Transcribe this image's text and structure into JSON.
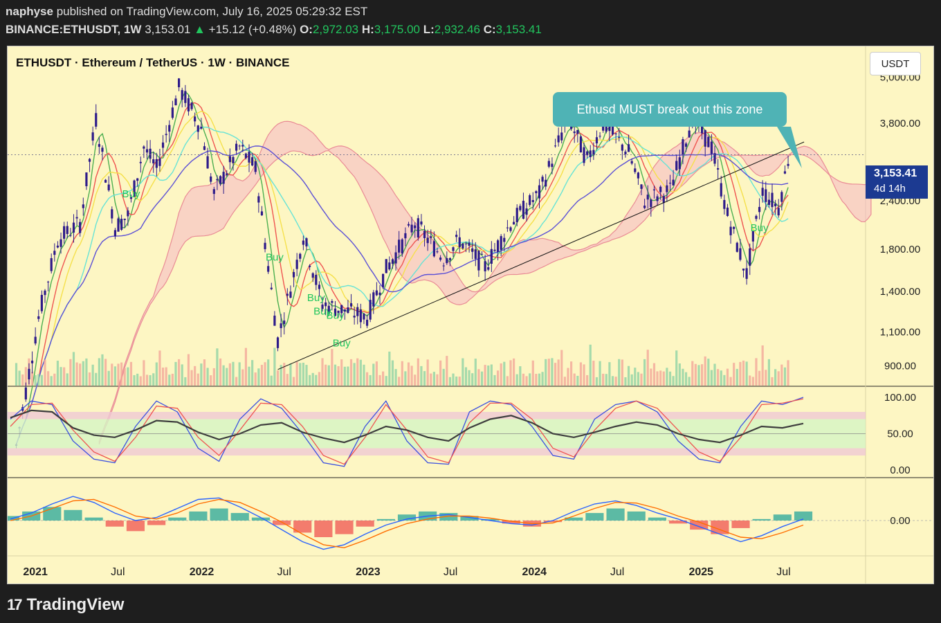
{
  "header": {
    "publisher": "naphyse",
    "published_text": "published on TradingView.com, July 16, 2025 05:29:32 EST",
    "symbol": "BINANCE:ETHUSDT, 1W",
    "last": "3,153.01",
    "change_arrow": "▲",
    "change": "+15.12 (+0.48%)",
    "o_label": "O:",
    "o": "2,972.03",
    "h_label": "H:",
    "h": "3,175.00",
    "l_label": "L:",
    "l": "2,932.46",
    "c_label": "C:",
    "c": "3,153.41"
  },
  "chart_title": "ETHUSDT · Ethereum / TetherUS · 1W · BINANCE",
  "currency": "USDT",
  "callout": "Ethusd MUST break out this zone",
  "price_tag": {
    "value": "3,153.41",
    "countdown": "4d 14h"
  },
  "footer": {
    "logo_text": "TradingView"
  },
  "colors": {
    "chart_bg": "#fdf6c3",
    "candle": "#2d1b8a",
    "up": "#22c55e",
    "down": "#ef5350",
    "callout": "#4fb3b5",
    "price_tag": "#1c3a91",
    "ichimoku_bull": "#5aa9d6",
    "ichimoku_bear": "#f5b7c4"
  },
  "chart_data": [
    {
      "type": "candlestick",
      "title": "ETHUSDT · Ethereum / TetherUS · 1W · BINANCE",
      "scale": "log",
      "ylim": [
        800,
        6000
      ],
      "y_ticks": [
        "5,000.00",
        "3,800.00",
        "2,400.00",
        "1,800.00",
        "1,400.00",
        "1,100.00",
        "900.00"
      ],
      "y_tick_values": [
        5000,
        3800,
        2400,
        1800,
        1400,
        1100,
        900
      ],
      "x_ticks": [
        "2021",
        "Jul",
        "2022",
        "Jul",
        "2023",
        "Jul",
        "2024",
        "Jul",
        "2025",
        "Jul"
      ],
      "x_tick_dates": [
        "2021-01-01",
        "2021-07-01",
        "2022-01-01",
        "2022-07-01",
        "2023-01-01",
        "2023-07-01",
        "2024-01-01",
        "2024-07-01",
        "2025-01-01",
        "2025-07-01"
      ],
      "x_range": [
        "2020-11-01",
        "2025-12-28"
      ],
      "current_price": 3153.41,
      "close_path": [
        [
          "2020-11-20",
          560
        ],
        [
          "2021-01-08",
          1200
        ],
        [
          "2021-02-19",
          1900
        ],
        [
          "2021-04-09",
          2100
        ],
        [
          "2021-05-14",
          3900
        ],
        [
          "2021-06-25",
          2050
        ],
        [
          "2021-07-23",
          2200
        ],
        [
          "2021-08-27",
          3300
        ],
        [
          "2021-09-24",
          2900
        ],
        [
          "2021-11-12",
          4700
        ],
        [
          "2021-12-31",
          3700
        ],
        [
          "2022-01-28",
          2500
        ],
        [
          "2022-03-25",
          3300
        ],
        [
          "2022-04-29",
          2900
        ],
        [
          "2022-06-17",
          1050
        ],
        [
          "2022-08-12",
          1950
        ],
        [
          "2022-09-23",
          1300
        ],
        [
          "2022-11-11",
          1250
        ],
        [
          "2022-12-30",
          1200
        ],
        [
          "2023-02-10",
          1600
        ],
        [
          "2023-04-14",
          2100
        ],
        [
          "2023-06-16",
          1700
        ],
        [
          "2023-07-21",
          1900
        ],
        [
          "2023-09-15",
          1620
        ],
        [
          "2023-11-10",
          2100
        ],
        [
          "2024-01-12",
          2500
        ],
        [
          "2024-03-15",
          3950
        ],
        [
          "2024-04-26",
          3050
        ],
        [
          "2024-05-31",
          3800
        ],
        [
          "2024-07-26",
          3200
        ],
        [
          "2024-08-30",
          2400
        ],
        [
          "2024-10-25",
          2550
        ],
        [
          "2024-12-13",
          3950
        ],
        [
          "2025-01-24",
          3300
        ],
        [
          "2025-02-28",
          2200
        ],
        [
          "2025-04-11",
          1550
        ],
        [
          "2025-05-16",
          2550
        ],
        [
          "2025-06-20",
          2300
        ],
        [
          "2025-07-13",
          3153
        ]
      ],
      "indicators": [
        "Ichimoku Cloud",
        "Moving Average Ribbon",
        "Volume"
      ],
      "trendline": {
        "from": [
          "2022-06-17",
          880
        ],
        "to": [
          "2025-08-15",
          3400
        ]
      },
      "annotations": [
        {
          "text": "Buy",
          "date": "2021-07-30",
          "price": 2450
        },
        {
          "text": "Buy",
          "date": "2022-06-10",
          "price": 1680
        },
        {
          "text": "Buy",
          "date": "2022-09-09",
          "price": 1320
        },
        {
          "text": "Buy",
          "date": "2022-09-23",
          "price": 1220
        },
        {
          "text": "Buy",
          "date": "2022-10-21",
          "price": 1190
        },
        {
          "text": "Buy",
          "date": "2022-11-04",
          "price": 1010
        },
        {
          "text": "Buy",
          "date": "2025-05-09",
          "price": 2000
        }
      ]
    },
    {
      "type": "line",
      "title": "",
      "ylim": [
        0,
        100
      ],
      "y_ticks": [
        "100.00",
        "50.00",
        "0.00"
      ],
      "y_tick_values": [
        100,
        50,
        0
      ],
      "bands": [
        [
          20,
          30
        ],
        [
          30,
          70
        ],
        [
          70,
          80
        ]
      ],
      "series": [
        {
          "color": "#3b4fe0",
          "values": [
            70,
            95,
            90,
            40,
            15,
            10,
            60,
            95,
            80,
            30,
            12,
            70,
            98,
            85,
            50,
            10,
            5,
            60,
            95,
            40,
            10,
            8,
            80,
            95,
            90,
            60,
            20,
            15,
            70,
            90,
            95,
            80,
            40,
            15,
            10,
            60,
            95,
            90,
            100
          ]
        },
        {
          "color": "#ef5350",
          "values": [
            60,
            90,
            92,
            55,
            25,
            12,
            45,
            88,
            85,
            45,
            20,
            55,
            92,
            90,
            60,
            20,
            8,
            45,
            90,
            55,
            18,
            10,
            65,
            92,
            92,
            70,
            30,
            18,
            55,
            85,
            95,
            85,
            55,
            25,
            12,
            45,
            90,
            92,
            98
          ]
        },
        {
          "color": "#3d3d3d",
          "values": [
            72,
            82,
            80,
            58,
            48,
            45,
            55,
            68,
            66,
            52,
            42,
            50,
            62,
            65,
            52,
            44,
            38,
            48,
            60,
            55,
            45,
            40,
            58,
            70,
            75,
            65,
            50,
            45,
            52,
            60,
            66,
            62,
            50,
            42,
            38,
            48,
            60,
            58,
            64
          ]
        }
      ]
    },
    {
      "type": "histogram",
      "title": "",
      "y_ticks": [
        "0.00"
      ],
      "y_tick_values": [
        0
      ],
      "histogram": [
        15,
        30,
        45,
        35,
        10,
        -20,
        -35,
        -15,
        10,
        30,
        40,
        25,
        10,
        -15,
        -40,
        -55,
        -45,
        -20,
        5,
        20,
        30,
        25,
        15,
        5,
        -10,
        -20,
        -5,
        10,
        25,
        40,
        30,
        10,
        -10,
        -30,
        -45,
        -25,
        5,
        20,
        30
      ],
      "macd": [
        5,
        25,
        55,
        80,
        60,
        25,
        0,
        10,
        40,
        70,
        75,
        45,
        10,
        -30,
        -70,
        -95,
        -80,
        -45,
        -15,
        5,
        15,
        20,
        10,
        0,
        -10,
        -15,
        0,
        30,
        55,
        65,
        50,
        25,
        5,
        -20,
        -45,
        -70,
        -50,
        -20,
        5
      ],
      "signal": [
        0,
        15,
        40,
        65,
        70,
        45,
        15,
        5,
        25,
        55,
        70,
        60,
        30,
        -5,
        -45,
        -80,
        -90,
        -65,
        -35,
        -10,
        5,
        15,
        15,
        8,
        -2,
        -10,
        -8,
        15,
        40,
        60,
        58,
        40,
        15,
        -5,
        -30,
        -55,
        -60,
        -40,
        -15
      ]
    }
  ]
}
